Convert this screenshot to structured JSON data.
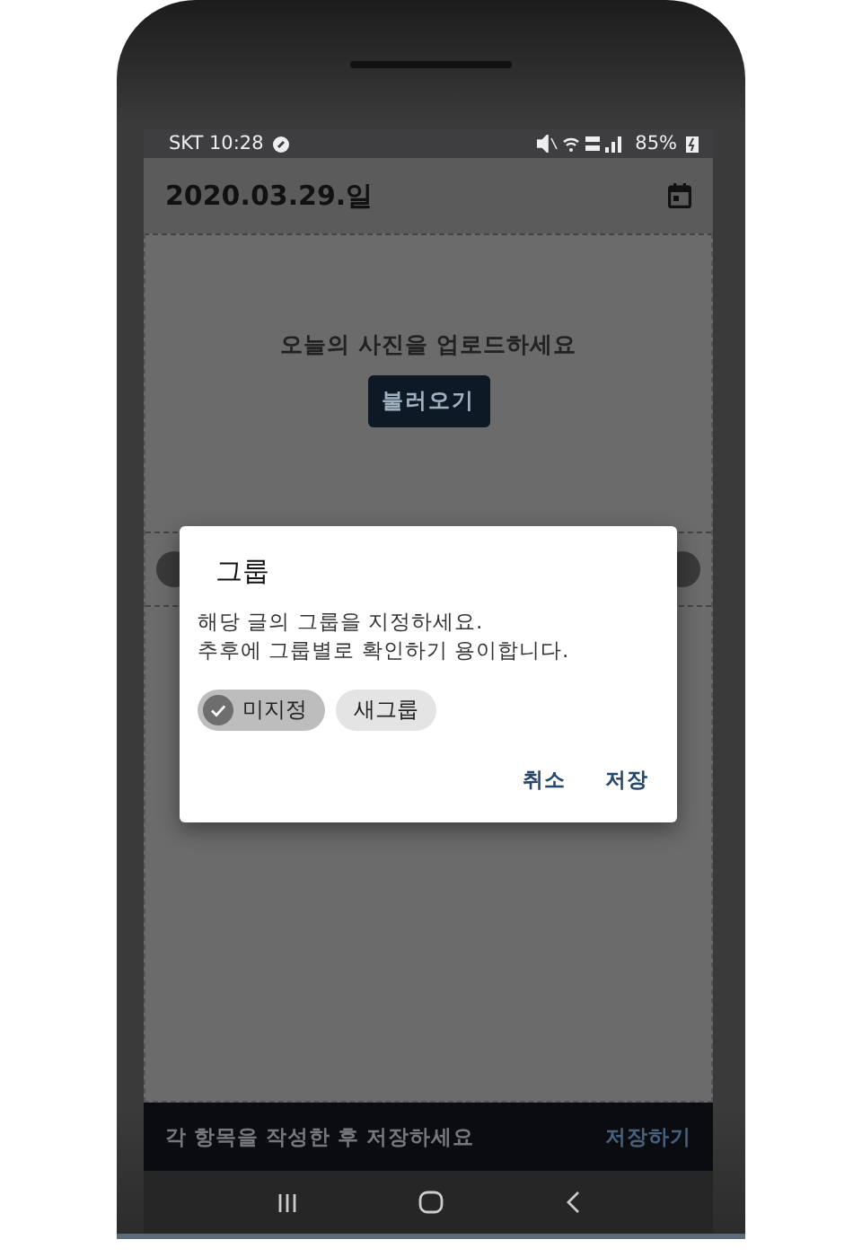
{
  "status_bar": {
    "carrier_time": "SKT 10:28",
    "battery": "85%"
  },
  "app_bar": {
    "title": "2020.03.29.일"
  },
  "upload": {
    "prompt": "오늘의 사진을 업로드하세요",
    "button": "불러오기"
  },
  "dialog": {
    "title": "그룹",
    "message": [
      "해당 글의 그룹을 지정하세요.",
      "추후에 그룹별로 확인하기 용이합니다."
    ],
    "chips": [
      {
        "label": "미지정",
        "selected": true
      },
      {
        "label": "새그룹",
        "selected": false
      }
    ],
    "buttons": [
      "취소",
      "저장"
    ]
  },
  "bottom_bar": {
    "hint": "각 항목을 작성한 후 저장하세요",
    "action": "저장하기"
  }
}
